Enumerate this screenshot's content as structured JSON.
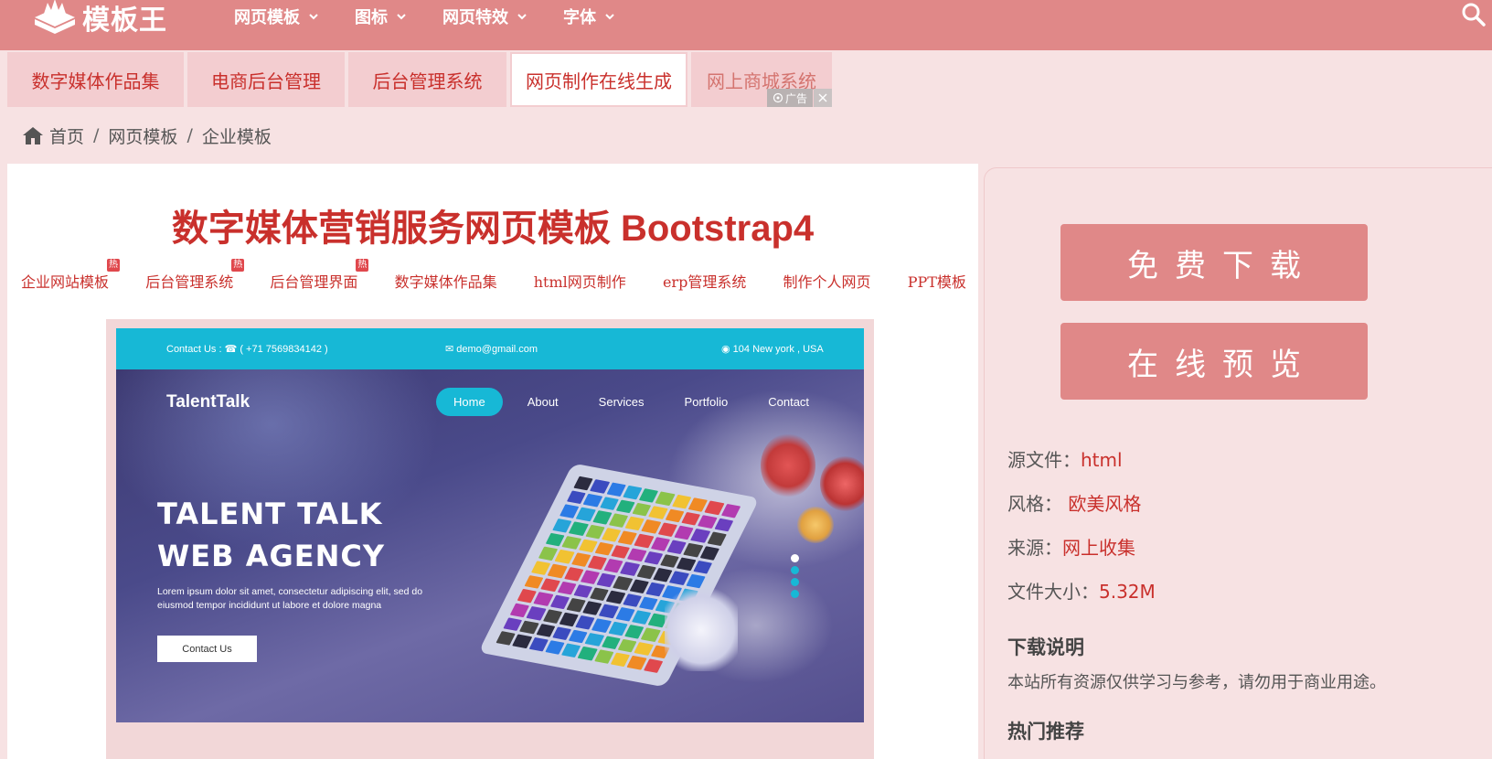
{
  "header": {
    "logo_text": "模板王",
    "nav": [
      {
        "label": "网页模板"
      },
      {
        "label": "图标"
      },
      {
        "label": "网页特效"
      },
      {
        "label": "字体"
      }
    ]
  },
  "ad_tabs": {
    "items": [
      {
        "label": "数字媒体作品集"
      },
      {
        "label": "电商后台管理"
      },
      {
        "label": "后台管理系统"
      },
      {
        "label": "网页制作在线生成"
      },
      {
        "label": "网上商城系统"
      }
    ],
    "ad_label": "广告"
  },
  "breadcrumb": {
    "items": [
      {
        "label": "首页"
      },
      {
        "label": "网页模板"
      },
      {
        "label": "企业模板"
      }
    ],
    "separator": "/"
  },
  "main": {
    "title": "数字媒体营销服务网页模板 Bootstrap4",
    "hot_badge": "热",
    "tags": [
      {
        "label": "企业网站模板",
        "hot": true
      },
      {
        "label": "后台管理系统",
        "hot": true
      },
      {
        "label": "后台管理界面",
        "hot": true
      },
      {
        "label": "数字媒体作品集",
        "hot": false
      },
      {
        "label": "html网页制作",
        "hot": false
      },
      {
        "label": "erp管理系统",
        "hot": false
      },
      {
        "label": "制作个人网页",
        "hot": false
      },
      {
        "label": "PPT模板",
        "hot": false
      }
    ]
  },
  "preview": {
    "contact": "Contact Us : ☎ ( +71 7569834142 )",
    "email": "✉ demo@gmail.com",
    "location": "◉ 104 New york , USA",
    "brand": "TalentTalk",
    "nav": [
      "Home",
      "About",
      "Services",
      "Portfolio",
      "Contact"
    ],
    "headline_1": "TALENT TALK",
    "headline_2": "WEB AGENCY",
    "paragraph": "Lorem ipsum dolor sit amet, consectetur adipiscing elit, sed do eiusmod tempor incididunt ut labore et dolore magna",
    "button": "Contact Us",
    "slides_total": 4,
    "slide_active": 1
  },
  "sidebar": {
    "download_button": "免费下载",
    "preview_button": "在线预览",
    "info": [
      {
        "label": "源文件：",
        "value": "html"
      },
      {
        "label": "风格： ",
        "value": "欧美风格"
      },
      {
        "label": "来源：",
        "value": "网上收集"
      },
      {
        "label": "文件大小：",
        "value": "5.32M"
      }
    ],
    "download_title": "下载说明",
    "download_text": "本站所有资源仅供学习与参考，请勿用于商业用途。",
    "hot_title": "热门推荐"
  },
  "colors": {
    "brand": "#e08888",
    "accent_text": "#c9302c",
    "background": "#f7e2e3",
    "preview_accent": "#17b8d6"
  }
}
